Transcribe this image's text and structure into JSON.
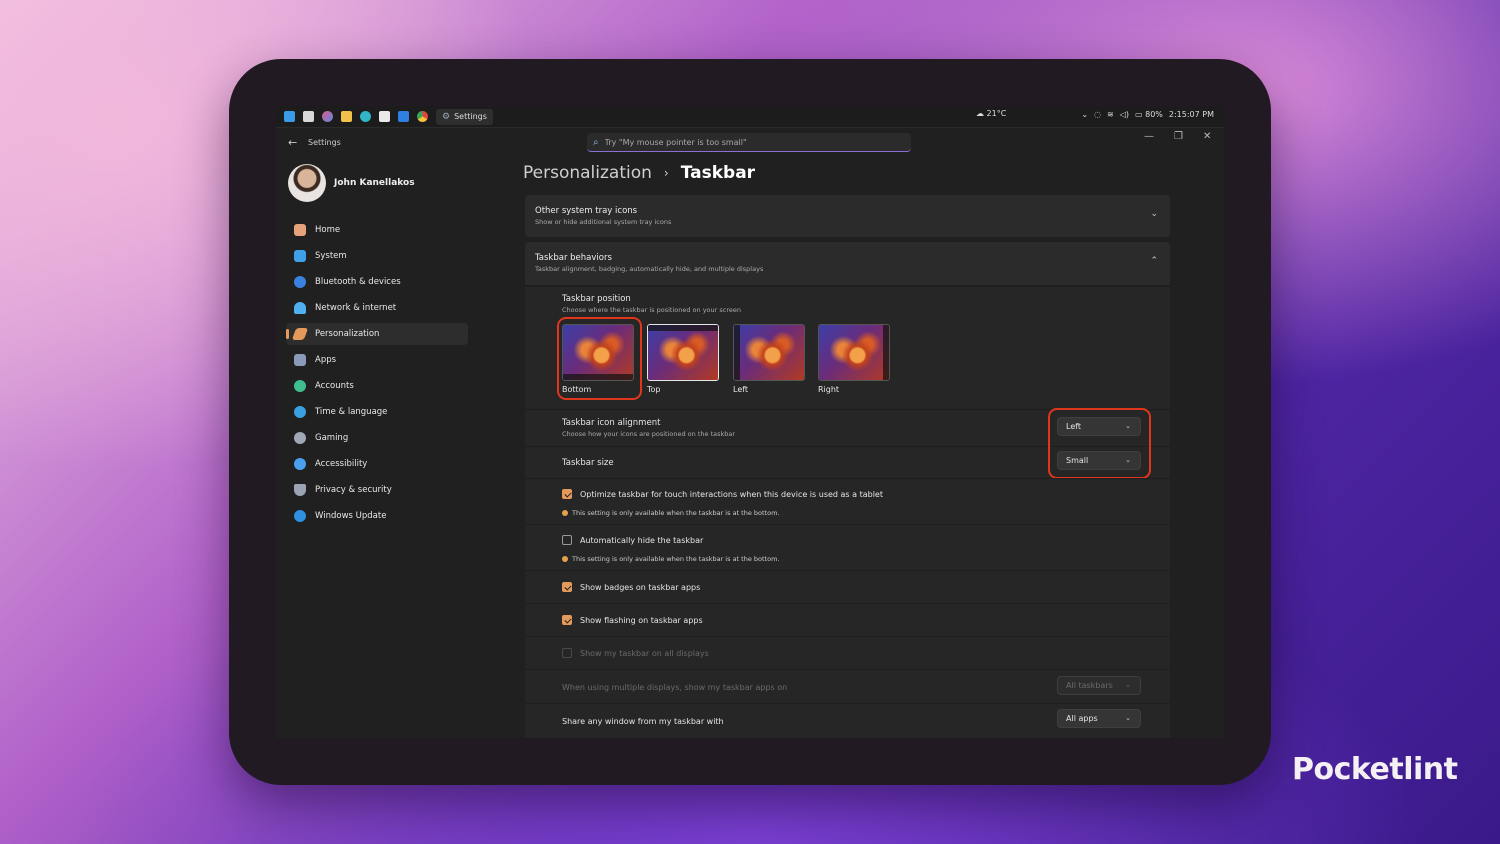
{
  "taskbar": {
    "app_label": "Settings",
    "weather": "21°C",
    "battery": "80%",
    "time": "2:15:07 PM"
  },
  "window": {
    "title": "Settings",
    "search_placeholder": "Try \"My mouse pointer is too small\""
  },
  "profile": {
    "name": "John Kanellakos"
  },
  "sidebar": {
    "items": [
      {
        "label": "Home",
        "color": "#e6a27a"
      },
      {
        "label": "System",
        "color": "#3ea0e6"
      },
      {
        "label": "Bluetooth & devices",
        "color": "#3b82e0"
      },
      {
        "label": "Network & internet",
        "color": "#4fb0f0"
      },
      {
        "label": "Personalization",
        "color": "#e39a5a",
        "active": true
      },
      {
        "label": "Apps",
        "color": "#8a9ab8"
      },
      {
        "label": "Accounts",
        "color": "#3fbf8f"
      },
      {
        "label": "Time & language",
        "color": "#3ba0e0"
      },
      {
        "label": "Gaming",
        "color": "#a0a8b8"
      },
      {
        "label": "Accessibility",
        "color": "#4aa0f0"
      },
      {
        "label": "Privacy & security",
        "color": "#9aa4b4"
      },
      {
        "label": "Windows Update",
        "color": "#2f8fe0"
      }
    ]
  },
  "breadcrumb": {
    "parent": "Personalization",
    "current": "Taskbar"
  },
  "cards": {
    "tray": {
      "title": "Other system tray icons",
      "subtitle": "Show or hide additional system tray icons"
    },
    "behaviors": {
      "title": "Taskbar behaviors",
      "subtitle": "Taskbar alignment, badging, automatically hide, and multiple displays"
    }
  },
  "position": {
    "title": "Taskbar position",
    "subtitle": "Choose where the taskbar is positioned on your screen",
    "options": [
      "Bottom",
      "Top",
      "Left",
      "Right"
    ],
    "selected": "Top"
  },
  "alignment": {
    "title": "Taskbar icon alignment",
    "subtitle": "Choose how your icons are positioned on the taskbar",
    "value": "Left"
  },
  "size": {
    "title": "Taskbar size",
    "value": "Small"
  },
  "options": {
    "optimize_touch": "Optimize taskbar for touch interactions when this device is used as a tablet",
    "note": "This setting is only available when the taskbar is at the bottom.",
    "auto_hide": "Automatically hide the taskbar",
    "badges": "Show badges on taskbar apps",
    "flashing": "Show flashing on taskbar apps",
    "all_displays": "Show my taskbar on all displays",
    "multi_display": "When using multiple displays, show my taskbar apps on",
    "multi_display_value": "All taskbars",
    "share": "Share any window from my taskbar with",
    "share_value": "All apps"
  },
  "brand": {
    "logo": "Pocketlint"
  },
  "colors": {
    "accent": "#e39a5a",
    "highlight": "#e0361b"
  }
}
